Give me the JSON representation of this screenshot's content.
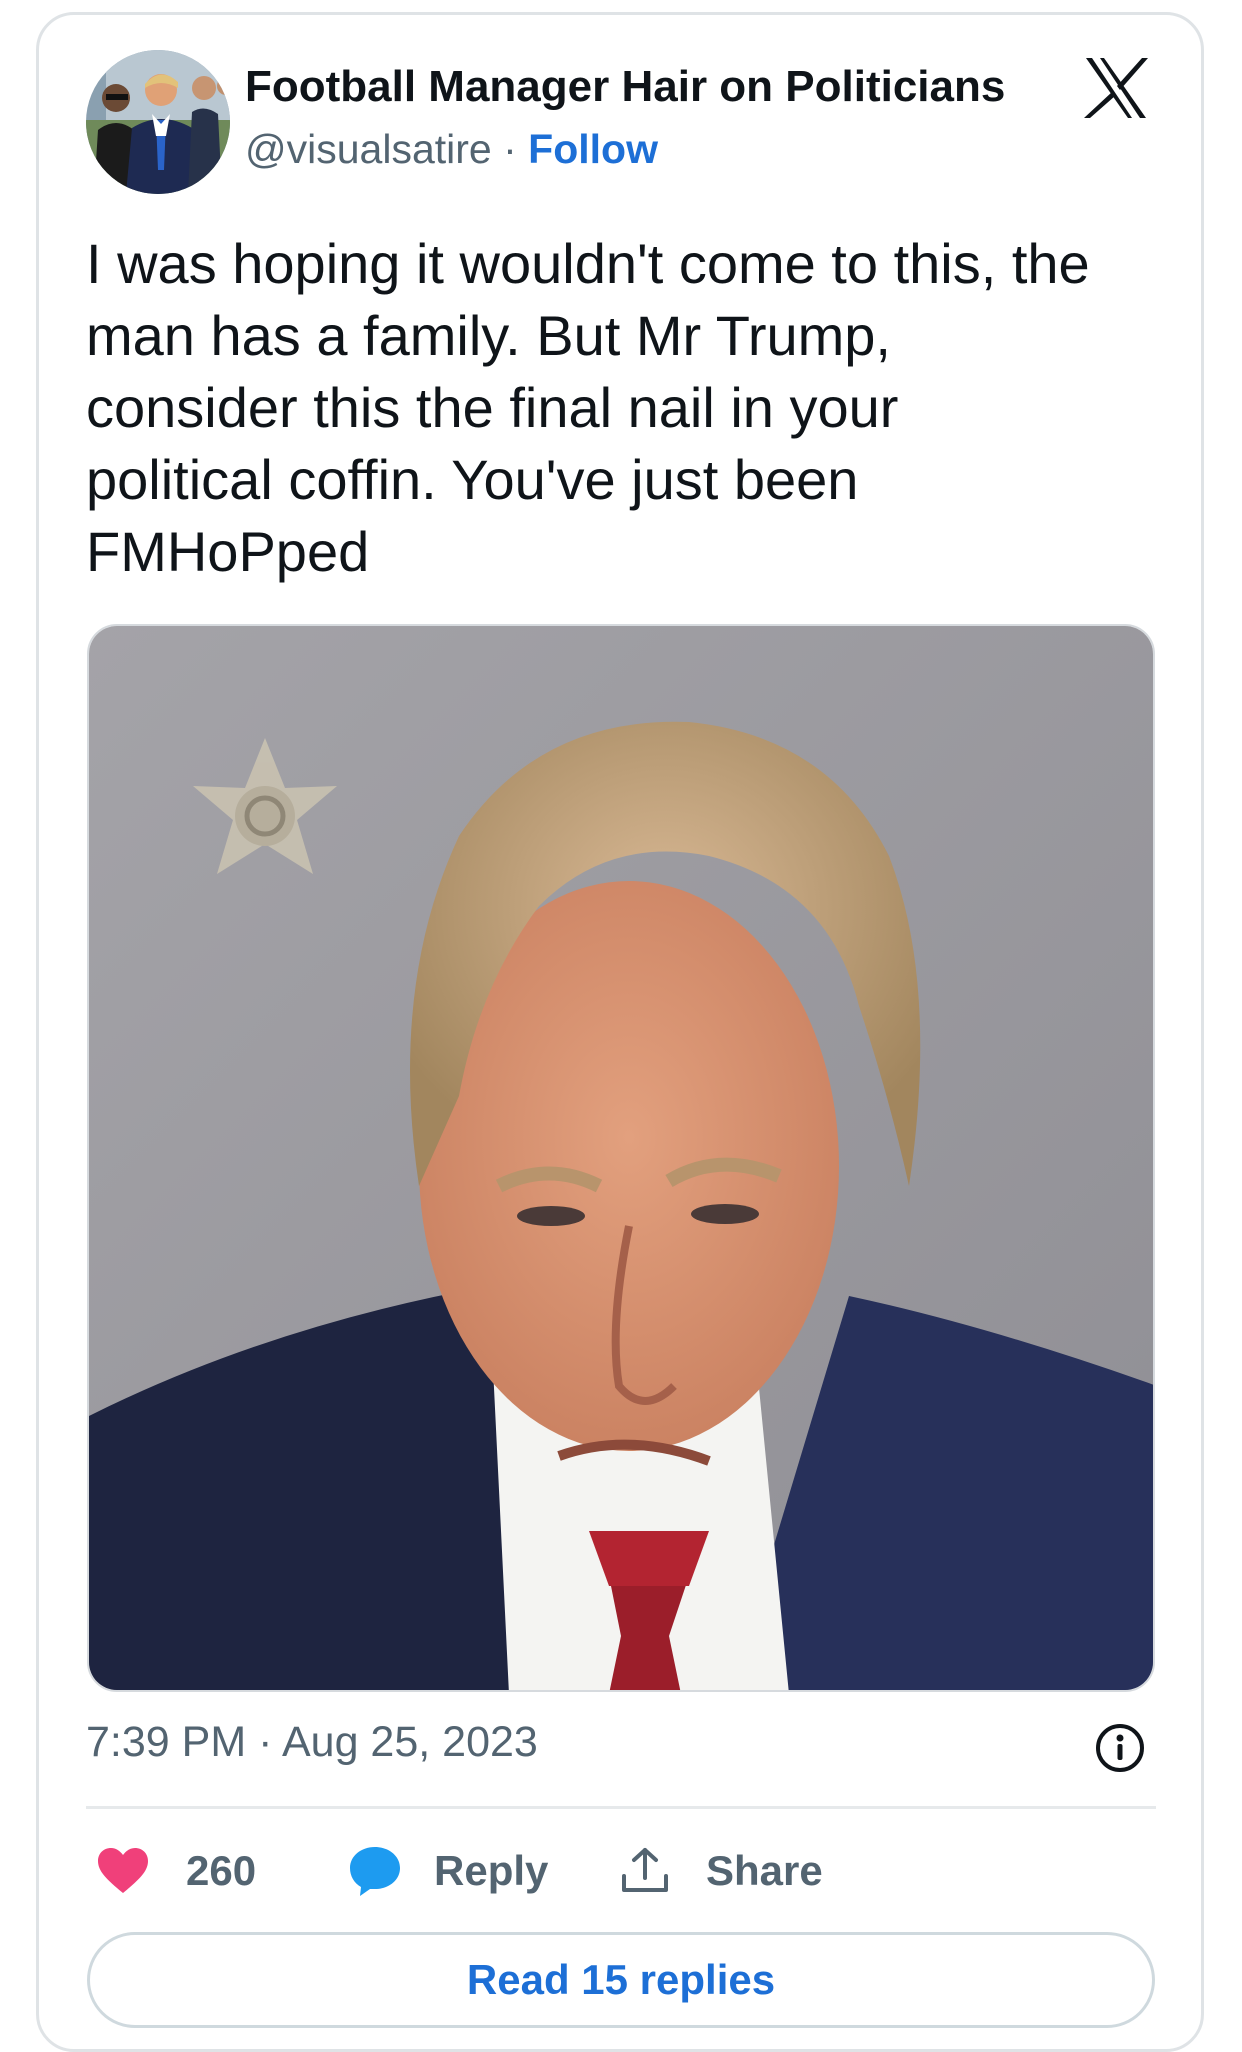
{
  "author": {
    "display_name": "Football Manager Hair on Politicians",
    "handle": "@visualsatire",
    "separator": "·",
    "follow_label": "Follow",
    "avatar_icon": "profile-photo"
  },
  "platform_icon": "x-logo-icon",
  "tweet": {
    "text": "I was hoping it wouldn't come to this, the\nman has a family. But Mr Trump,\nconsider this the final nail in your\npolitical coffin. You've just been\nFMHoPped",
    "media_icon": "edited-mugshot-photo",
    "timestamp": "7:39 PM · Aug 25, 2023"
  },
  "actions": {
    "like_count": "260",
    "reply_label": "Reply",
    "share_label": "Share"
  },
  "read_replies_label": "Read 15 replies",
  "colors": {
    "accent": "#1d6fd6",
    "like": "#f0407a",
    "reply_bubble": "#1d9bf0",
    "muted_text": "#536471",
    "border": "#dfe3e6"
  }
}
